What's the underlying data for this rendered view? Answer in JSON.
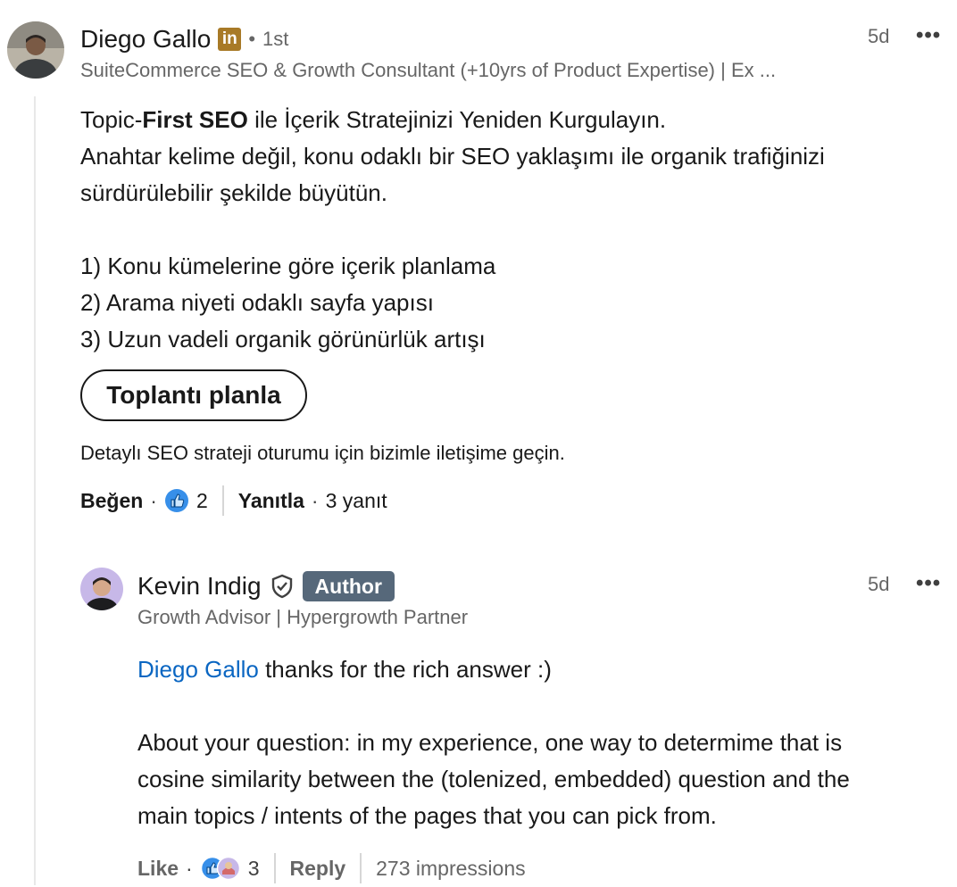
{
  "comment": {
    "author": {
      "name": "Diego Gallo",
      "premium_badge": "in",
      "degree": "1st",
      "headline": "SuiteCommerce SEO & Growth Consultant (+10yrs of Product Expertise) | Ex ..."
    },
    "time": "5d",
    "more_label": "•••",
    "body": {
      "line1_prefix": "Topic-",
      "line1_bold": "First SEO",
      "line1_suffix": " ile İçerik Stratejinizi Yeniden Kurgulayın.",
      "line2": "Anahtar kelime değil, konu odaklı bir SEO yaklaşımı ile organik trafiğinizi",
      "line3": "sürdürülebilir şekilde büyütün.",
      "list": [
        "1) Konu kümelerine göre içerik planlama",
        "2) Arama niyeti odaklı sayfa yapısı",
        "3) Uzun vadeli organik görünürlük artışı"
      ]
    },
    "cta_label": "Toplantı planla",
    "cta_caption": "Detaylı SEO strateji oturumu için bizimle iletişime geçin.",
    "actions": {
      "like_label": "Beğen",
      "reaction_count": "2",
      "reply_label": "Yanıtla",
      "replies_count": "3 yanıt"
    }
  },
  "reply": {
    "author": {
      "name": "Kevin Indig",
      "badge": "Author",
      "headline": "Growth Advisor | Hypergrowth Partner"
    },
    "time": "5d",
    "more_label": "•••",
    "mention": "Diego Gallo",
    "line1_rest": " thanks for the rich answer :)",
    "para2": [
      "About your question: in my experience, one way to determime that is",
      "cosine similarity between the (tolenized, embedded) question and the",
      "main topics / intents of the pages that you can pick from."
    ],
    "actions": {
      "like_label": "Like",
      "reaction_count": "3",
      "reply_label": "Reply",
      "impressions": "273 impressions"
    }
  },
  "colors": {
    "link": "#0a66c2",
    "badge_bg": "#56687a",
    "premium": "#a87a27"
  }
}
